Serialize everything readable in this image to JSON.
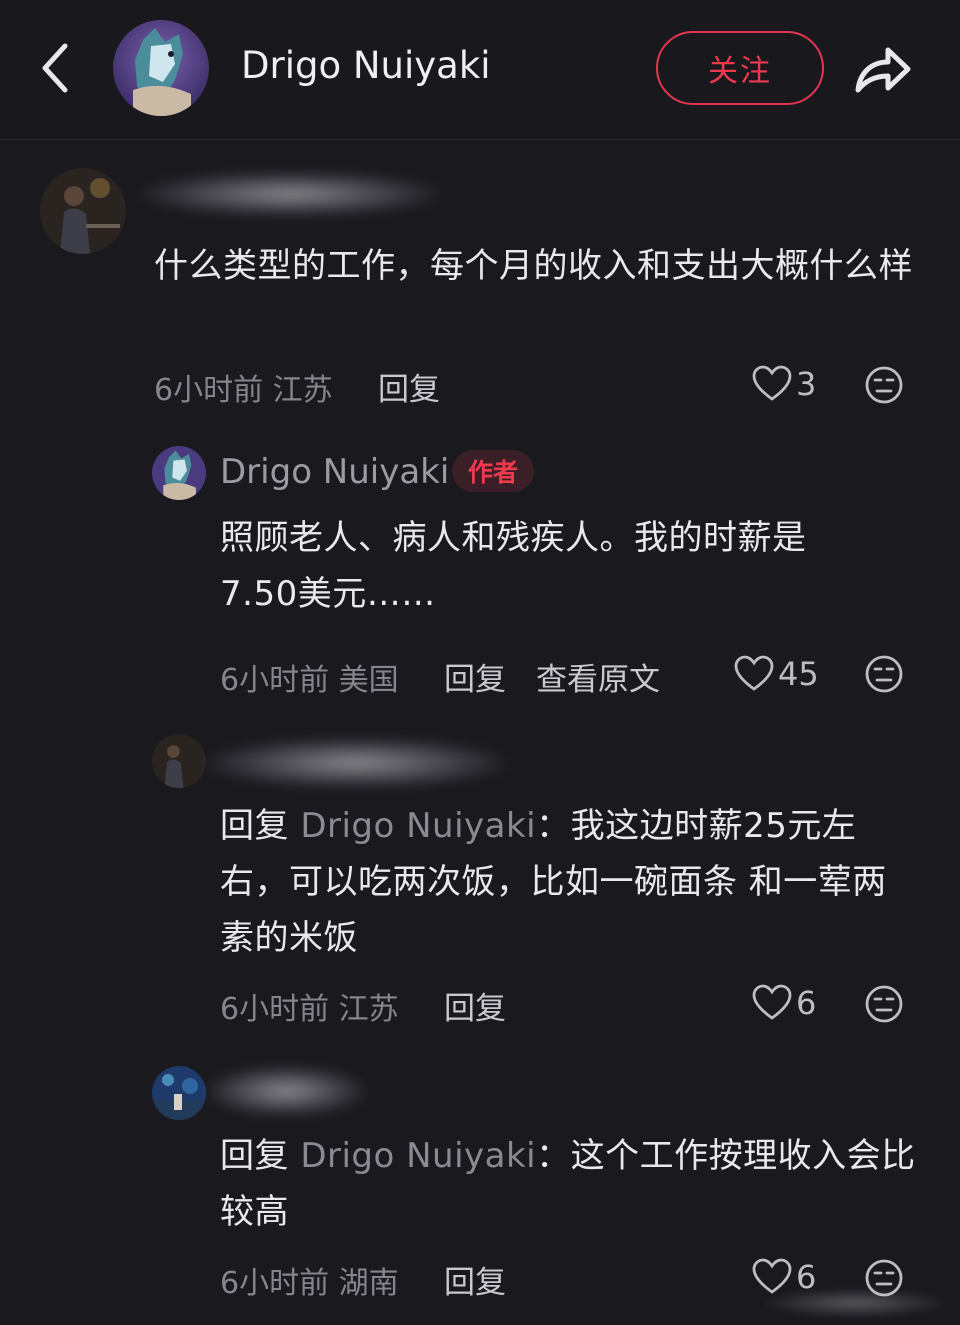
{
  "header": {
    "title": "Drigo Nuiyaki",
    "follow_label": "关注"
  },
  "colors": {
    "background": "#1a191e",
    "accent_red": "#f0394f",
    "muted_text": "#85858d"
  },
  "comments": [
    {
      "text": "什么类型的工作，每个月的收入和支出大概什么样",
      "time": "6小时前",
      "location": "江苏",
      "reply_label": "回复",
      "likes": "3"
    },
    {
      "name": "Drigo Nuiyaki",
      "badge": "作者",
      "text": "照顾老人、病人和残疾人。我的时薪是7.50美元……",
      "time": "6小时前",
      "location": "美国",
      "reply_label": "回复",
      "view_original_label": "查看原文",
      "likes": "45"
    },
    {
      "reply_prefix": "回复",
      "reply_to": "Drigo Nuiyaki",
      "text": "：我这边时薪25元左右，可以吃两次饭，比如一碗面条 和一荤两素的米饭",
      "time": "6小时前",
      "location": "江苏",
      "reply_label": "回复",
      "likes": "6"
    },
    {
      "reply_prefix": "回复",
      "reply_to": "Drigo Nuiyaki",
      "text": "：这个工作按理收入会比较高",
      "time": "6小时前",
      "location": "湖南",
      "reply_label": "回复",
      "likes": "6"
    }
  ]
}
